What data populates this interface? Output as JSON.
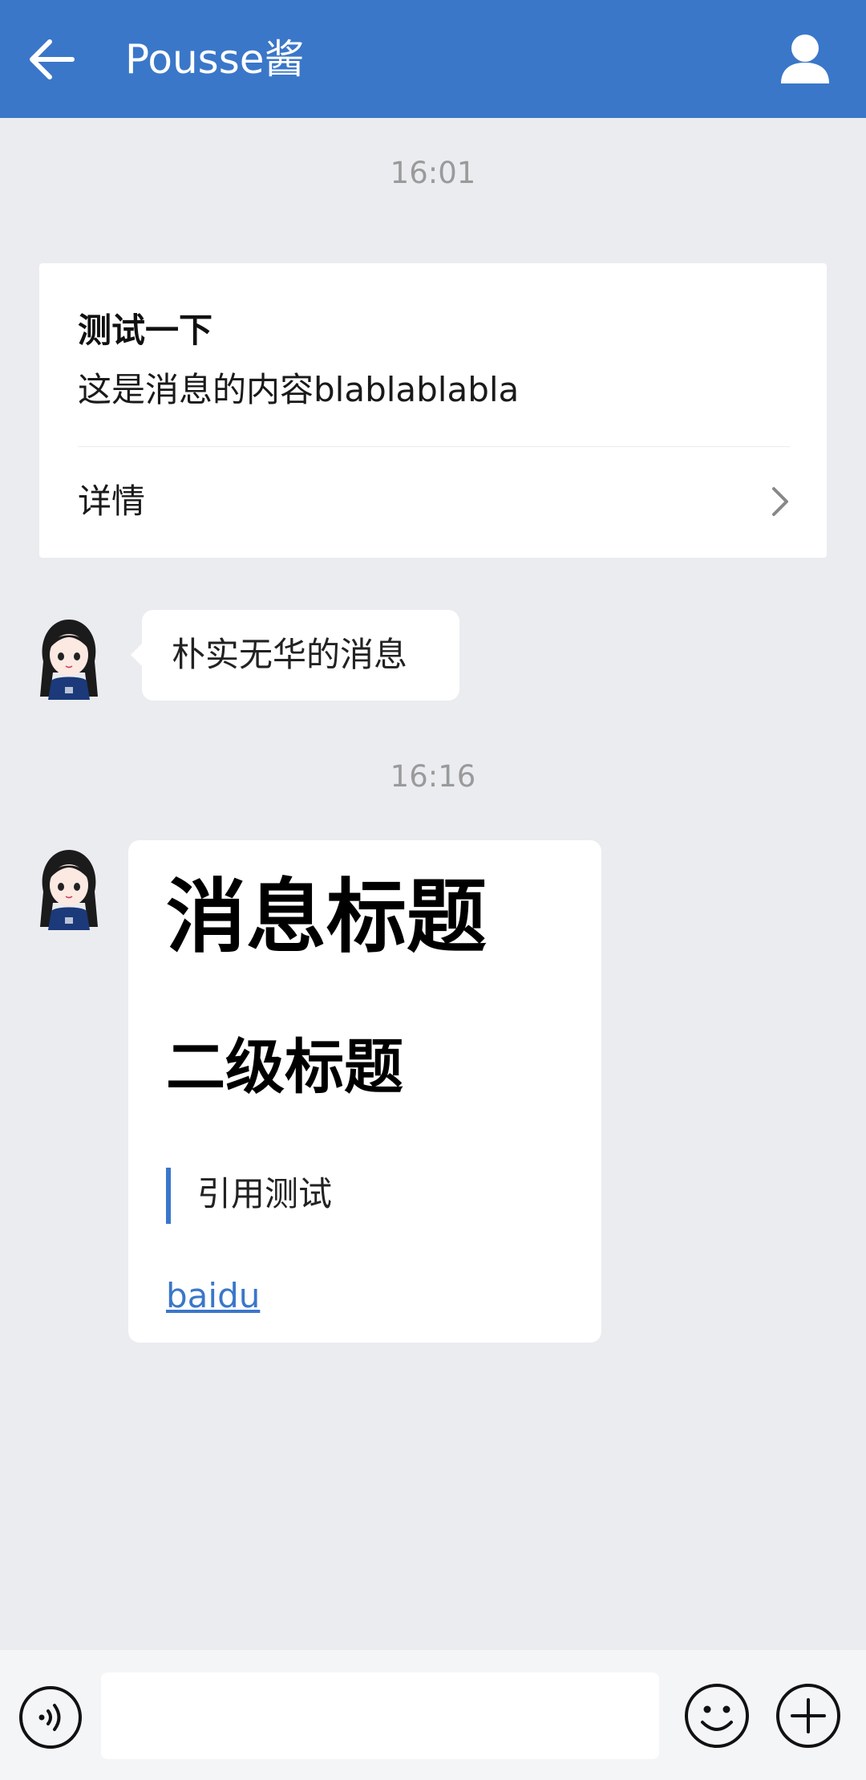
{
  "header": {
    "title": "Pousse酱",
    "back_icon": "arrow-left-icon",
    "profile_icon": "person-icon",
    "background_color": "#3a77c9"
  },
  "messages": {
    "timestamp_1": "16:01",
    "card": {
      "title": "测试一下",
      "content": "这是消息的内容blablablabla",
      "detail_label": "详情",
      "detail_icon": "chevron-right-icon"
    },
    "text_bubble": {
      "text": "朴实无华的消息",
      "avatar_icon": "girl-avatar"
    },
    "timestamp_2": "16:16",
    "rich": {
      "heading_1": "消息标题",
      "heading_2": "二级标题",
      "quote": "引用测试",
      "link_text": "baidu",
      "link_color": "#3a77c9",
      "avatar_icon": "girl-avatar"
    }
  },
  "input_bar": {
    "voice_icon": "voice-icon",
    "input_value": "",
    "emoji_icon": "smiley-icon",
    "plus_icon": "plus-circle-icon"
  }
}
